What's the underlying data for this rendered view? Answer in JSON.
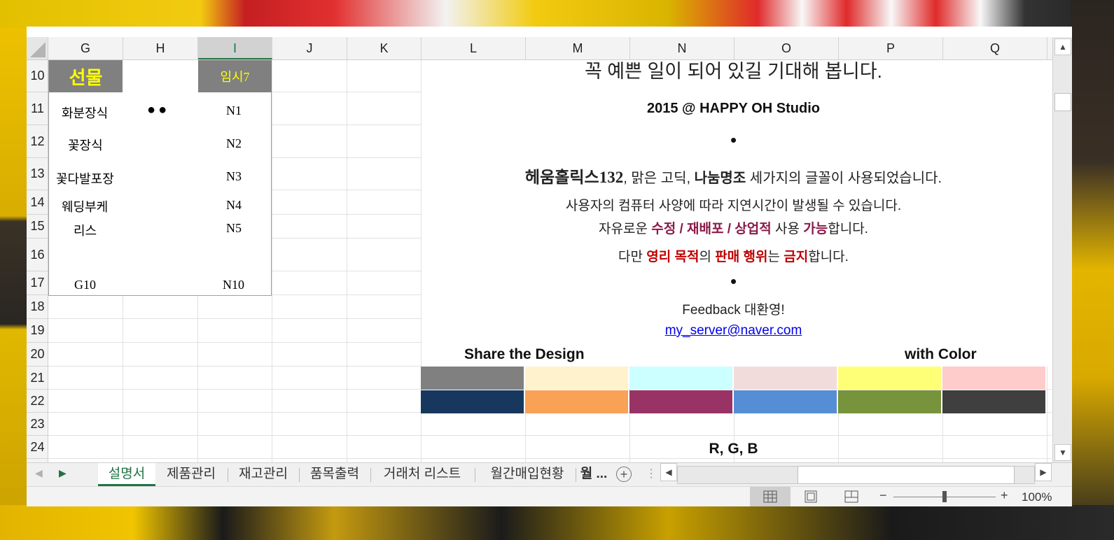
{
  "columns": [
    "G",
    "H",
    "I",
    "J",
    "K",
    "L",
    "M",
    "N",
    "O",
    "P",
    "Q"
  ],
  "selected_column": "I",
  "rows": [
    "10",
    "11",
    "12",
    "13",
    "14",
    "15",
    "16",
    "17",
    "18",
    "19",
    "20",
    "21",
    "22",
    "23",
    "24"
  ],
  "left_table": {
    "header_gift": "선물",
    "header_temp": "임시7",
    "items": [
      {
        "name": "화분장식",
        "code": "N1"
      },
      {
        "name": "꽃장식",
        "code": "N2"
      },
      {
        "name": "꽃다발포장",
        "code": "N3"
      },
      {
        "name": "웨딩부케",
        "code": "N4"
      },
      {
        "name": "리스",
        "code": "N5"
      },
      {
        "name": "",
        "code": ""
      },
      {
        "name": "G10",
        "code": "N10"
      }
    ],
    "dots": "●●"
  },
  "content": {
    "top_line": "꼭 예쁜 일이 되어 있길 기대해 봅니다.",
    "studio": "2015 @ HAPPY OH Studio",
    "bullet": "•",
    "fonts_line": {
      "font1": "헤움홀릭스132",
      "sep1": ", 맑은 고딕, ",
      "font3": "나눔명조",
      "rest": " 세가지의 글꼴이 사용되었습니다."
    },
    "delay_line": "사용자의 컴퓨터 사양에 따라 지연시간이 발생될 수 있습니다.",
    "free_line": {
      "pre": "자유로운 ",
      "hl1": "수정 / 재배포 / 상업적",
      "mid": " 사용 ",
      "hl2": "가능",
      "post": "합니다."
    },
    "ban_line": {
      "pre": "다만 ",
      "hl1": "영리 목적",
      "mid1": "의 ",
      "hl2": "판매 행위",
      "mid2": "는 ",
      "hl3": "금지",
      "post": "합니다."
    },
    "feedback": "Feedback 대환영!",
    "email": "my_server@naver.com",
    "share_left": "Share the Design",
    "share_right": "with Color",
    "rgb_label": "R, G, B"
  },
  "palette": {
    "row1": [
      "#808080",
      "#FFF2CC",
      "#CCFFFF",
      "#F2DCDB",
      "#FFFF77",
      "#FFCCCC"
    ],
    "row2": [
      "#17375E",
      "#F9A155",
      "#993366",
      "#558ED5",
      "#77933C",
      "#3F3F3F"
    ]
  },
  "colors": {
    "accent": "#217346",
    "highlight_purple": "#8B1A4A",
    "highlight_red": "#C00000",
    "link": "#0000EE"
  },
  "sheet_tabs": [
    "설명서",
    "제품관리",
    "재고관리",
    "품목출력",
    "거래처 리스트",
    "월간매입현황",
    "월 ..."
  ],
  "active_tab": "설명서",
  "status": {
    "zoom": "100%",
    "zoom_minus": "−",
    "zoom_plus": "+"
  }
}
